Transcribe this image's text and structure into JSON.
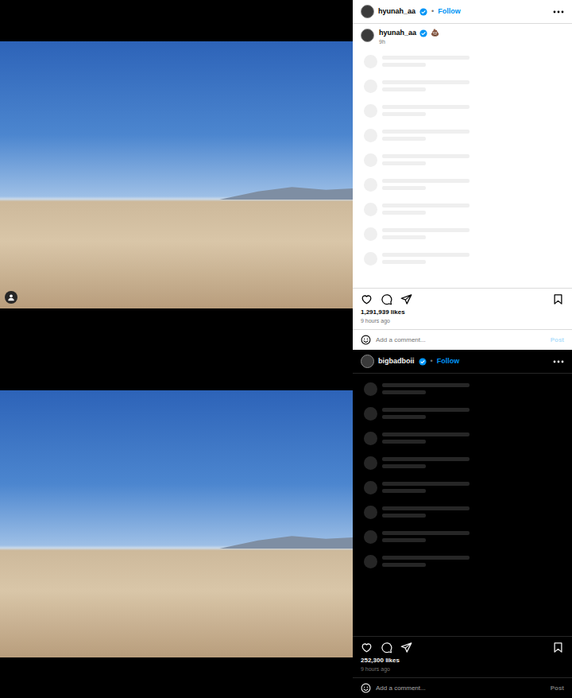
{
  "posts": [
    {
      "kind": "light",
      "username": "hyunah_aa",
      "verified": true,
      "separator": "•",
      "follow": "Follow",
      "tagged": true,
      "caption": {
        "username": "hyunah_aa",
        "verified": true,
        "text": "💩",
        "time": "9h"
      },
      "skeleton_rows": 9,
      "likes": "1,291,939 likes",
      "time": "9 hours ago",
      "comment": {
        "placeholder": "Add a comment...",
        "button": "Post",
        "disabled": true
      }
    },
    {
      "kind": "dark",
      "username": "bigbadboii",
      "verified": true,
      "separator": "•",
      "follow": "Follow",
      "tagged": false,
      "skeleton_rows": 8,
      "likes": "252,300 likes",
      "time": "9 hours ago",
      "comment": {
        "placeholder": "Add a comment...",
        "button": "Post",
        "disabled": true
      }
    }
  ]
}
